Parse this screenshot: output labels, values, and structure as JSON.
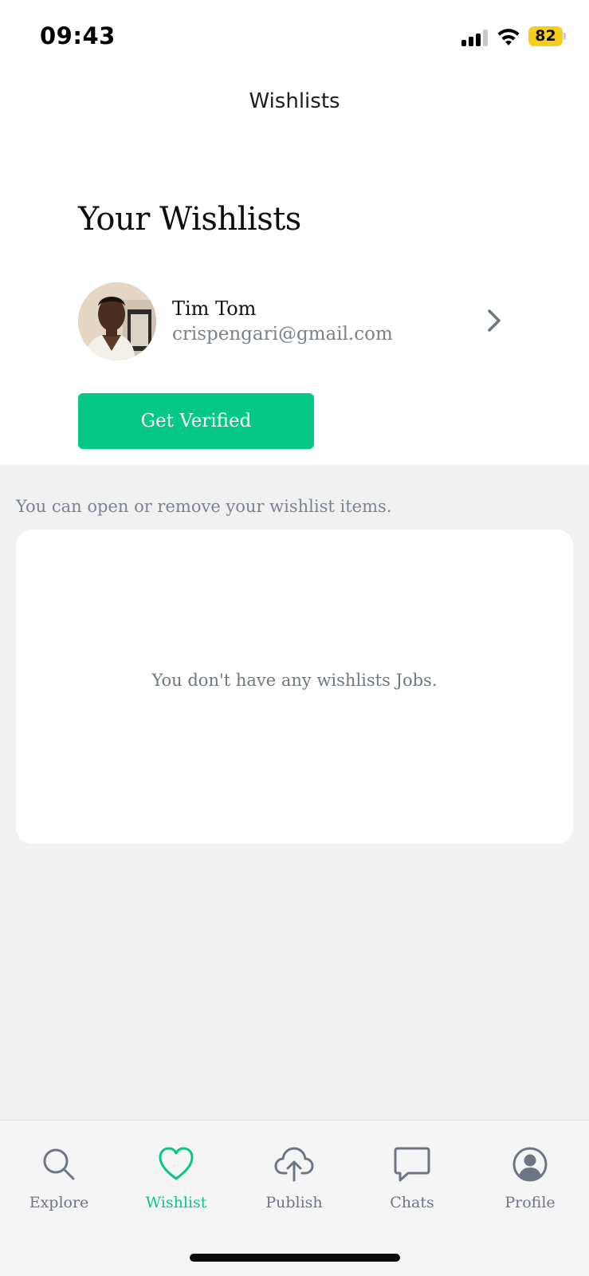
{
  "status_bar": {
    "time": "09:43",
    "battery": "82",
    "icons": [
      "signal-icon",
      "wifi-icon",
      "battery-icon"
    ]
  },
  "nav": {
    "title": "Wishlists"
  },
  "header": {
    "heading": "Your Wishlists"
  },
  "profile": {
    "name": "Tim Tom",
    "email": "crispengari@gmail.com",
    "icon": "chevron-right-icon"
  },
  "actions": {
    "verify_label": "Get Verified"
  },
  "wishlist": {
    "hint": "You can open or remove your wishlist items.",
    "empty_message": "You don't have any wishlists Jobs."
  },
  "tabs": [
    {
      "label": "Explore",
      "icon": "search-icon",
      "active": false
    },
    {
      "label": "Wishlist",
      "icon": "heart-icon",
      "active": true
    },
    {
      "label": "Publish",
      "icon": "cloud-upload-icon",
      "active": false
    },
    {
      "label": "Chats",
      "icon": "chat-bubble-icon",
      "active": false
    },
    {
      "label": "Profile",
      "icon": "user-circle-icon",
      "active": false
    }
  ],
  "colors": {
    "accent": "#06c886",
    "inactive_text": "#6e7684",
    "battery": "#f7cd1f",
    "section_background": "#f1f1f1"
  }
}
